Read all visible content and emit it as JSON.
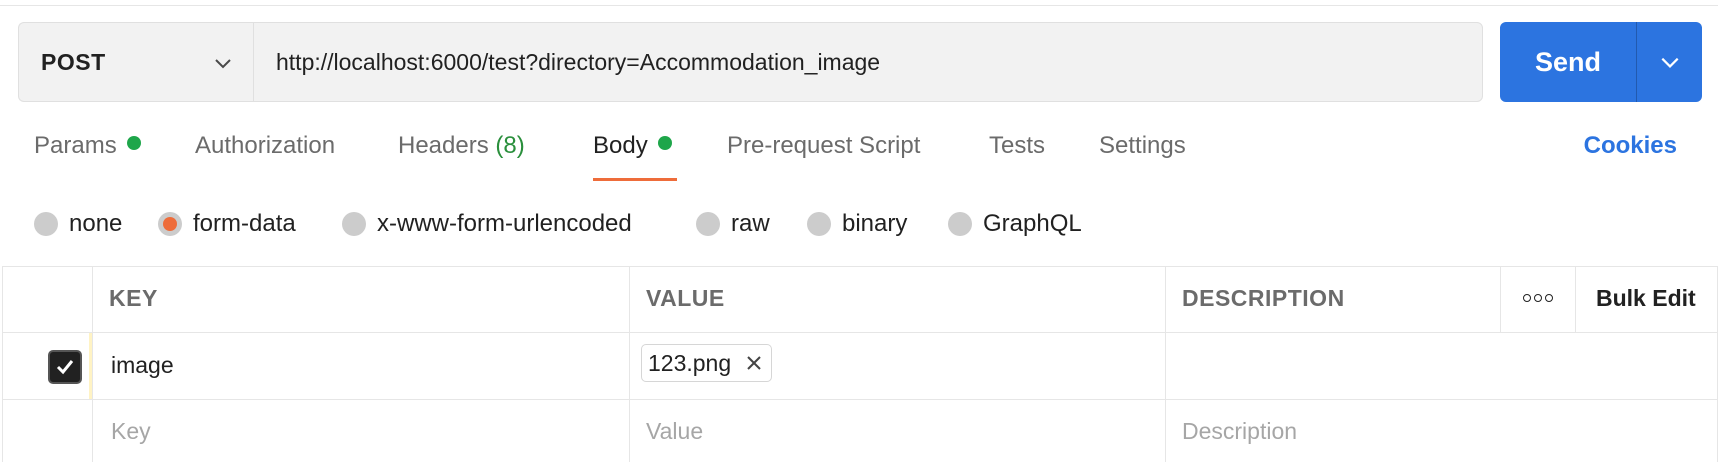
{
  "request": {
    "method": "POST",
    "url": "http://localhost:6000/test?directory=Accommodation_image",
    "send_label": "Send"
  },
  "tabs": [
    {
      "label": "Params",
      "has_dot": true
    },
    {
      "label": "Authorization"
    },
    {
      "label": "Headers",
      "count": "(8)"
    },
    {
      "label": "Body",
      "has_dot": true,
      "active": true
    },
    {
      "label": "Pre-request Script"
    },
    {
      "label": "Tests"
    },
    {
      "label": "Settings"
    }
  ],
  "cookies_label": "Cookies",
  "body_types": [
    {
      "label": "none"
    },
    {
      "label": "form-data",
      "selected": true
    },
    {
      "label": "x-www-form-urlencoded"
    },
    {
      "label": "raw"
    },
    {
      "label": "binary"
    },
    {
      "label": "GraphQL"
    }
  ],
  "table": {
    "headers": {
      "key": "KEY",
      "value": "VALUE",
      "description": "DESCRIPTION",
      "bulk_edit": "Bulk Edit"
    },
    "rows": [
      {
        "checked": true,
        "key": "image",
        "file": "123.png",
        "description": ""
      }
    ],
    "placeholders": {
      "key": "Key",
      "value": "Value",
      "description": "Description"
    }
  },
  "colors": {
    "accent": "#2c74e0",
    "active_tab": "#ee6c3a",
    "status_dot": "#1ea64a",
    "count_text": "#2a8f3c"
  }
}
